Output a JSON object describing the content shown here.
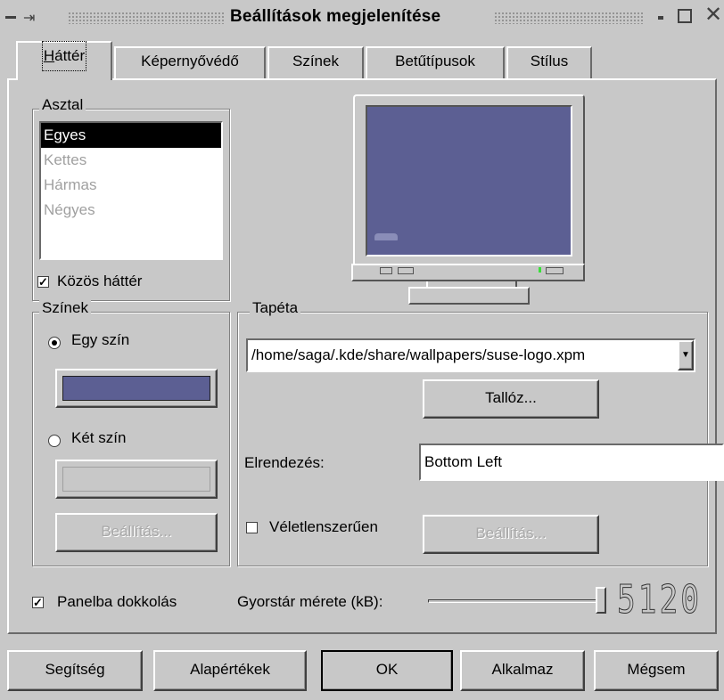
{
  "window": {
    "title": "Beállítások megjelenítése",
    "controls": [
      "minimize",
      "maximize",
      "close"
    ]
  },
  "tabs": [
    {
      "label": "Háttér",
      "mnemonic": "H",
      "active": true
    },
    {
      "label": "Képernyővédő",
      "mnemonic": "K",
      "active": false
    },
    {
      "label": "Színek",
      "mnemonic": "S",
      "active": false
    },
    {
      "label": "Betűtípusok",
      "mnemonic": "B",
      "active": false
    },
    {
      "label": "Stílus",
      "mnemonic": "S",
      "active": false
    }
  ],
  "desktop_group": {
    "legend": "Asztal",
    "items": [
      "Egyes",
      "Kettes",
      "Hármas",
      "Négyes"
    ],
    "selected": "Egyes",
    "common_background_label": "Közös háttér",
    "common_background_checked": true
  },
  "colors_group": {
    "legend": "Színek",
    "one_color_label": "Egy szín",
    "one_color_selected": true,
    "one_color_value": "#5c5f93",
    "two_color_label": "Két szín",
    "setup_button_label": "Beállítás..."
  },
  "wallpaper_group": {
    "legend": "Tapéta",
    "path": "/home/saga/.kde/share/wallpapers/suse-logo.xpm",
    "browse_button_label": "Tallóz...",
    "arrangement_label": "Elrendezés:",
    "arrangement_value": "Bottom Left",
    "random_label": "Véletlenszerűen",
    "random_checked": false,
    "setup_button_label": "Beállítás..."
  },
  "footer_options": {
    "dock_panel_label": "Panelba dokkolás",
    "dock_panel_checked": true,
    "cache_size_label": "Gyorstár mérete (kB):",
    "cache_size_value": "5120"
  },
  "buttons": {
    "help": "Segítség",
    "defaults": "Alapértékek",
    "ok": "OK",
    "apply": "Alkalmaz",
    "cancel": "Mégsem"
  },
  "colors": {
    "preview_screen": "#5c5f93",
    "window_bg": "#c8c8c8",
    "selection_bg": "#000000"
  }
}
